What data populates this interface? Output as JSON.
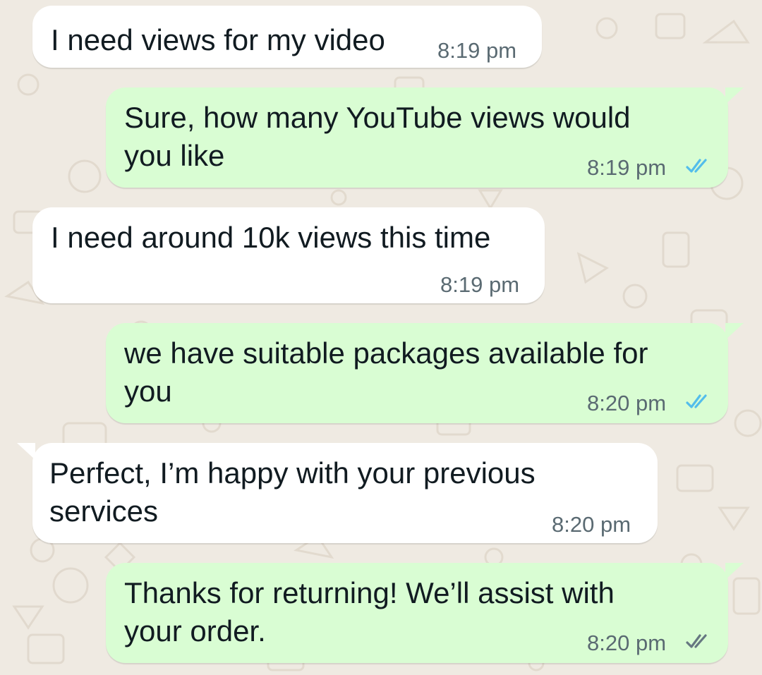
{
  "colors": {
    "background": "#efeae2",
    "incoming_bubble": "#ffffff",
    "outgoing_bubble": "#d9fdd3",
    "read_ticks": "#53bdeb",
    "delivered_ticks": "#667781"
  },
  "messages": [
    {
      "direction": "incoming",
      "text": "I need views for my video",
      "time": "8:19 pm"
    },
    {
      "direction": "outgoing",
      "text": "Sure, how many YouTube views would\nyou like",
      "time": "8:19 pm",
      "ticks": "read"
    },
    {
      "direction": "incoming",
      "text": "I need around 10k views this time",
      "time": "8:19 pm"
    },
    {
      "direction": "outgoing",
      "text": "we have suitable packages available for\nyou",
      "time": "8:20 pm",
      "ticks": "read"
    },
    {
      "direction": "incoming",
      "text": "Perfect, I’m happy with your previous\nservices",
      "time": "8:20 pm"
    },
    {
      "direction": "outgoing",
      "text": "Thanks for returning! We’ll assist with\nyour order.",
      "time": "8:20 pm",
      "ticks": "delivered"
    }
  ]
}
